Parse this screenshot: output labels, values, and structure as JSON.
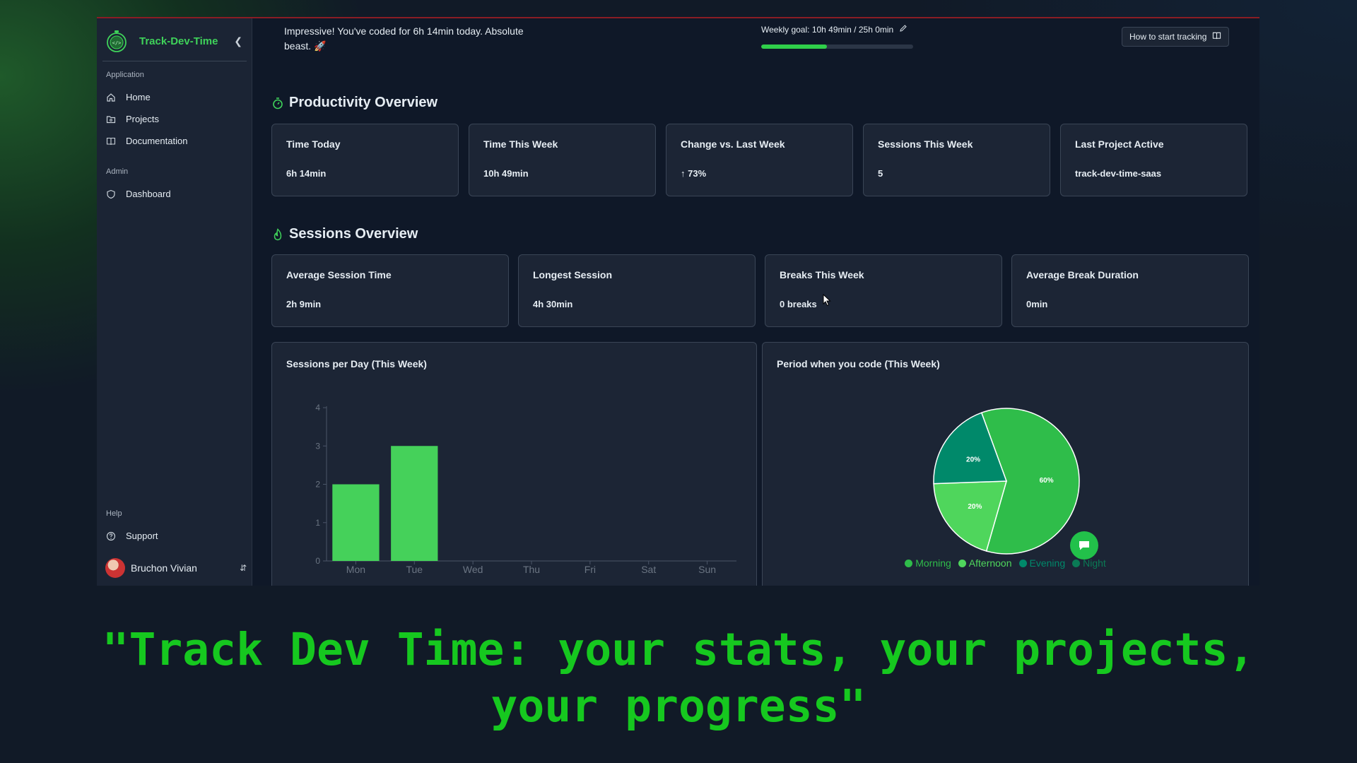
{
  "colors": {
    "accent": "#3fd25a",
    "morning": "#2fbd4a",
    "afternoon": "#4fd65c",
    "evening": "#00896a",
    "night": "#0a7a55",
    "bar": "#45d15a"
  },
  "sidebar": {
    "brand": "Track-Dev-Time",
    "groups": [
      {
        "label": "Application",
        "items": [
          {
            "label": "Home",
            "icon": "home-icon"
          },
          {
            "label": "Projects",
            "icon": "folder-icon"
          },
          {
            "label": "Documentation",
            "icon": "book-icon"
          }
        ]
      },
      {
        "label": "Admin",
        "items": [
          {
            "label": "Dashboard",
            "icon": "shield-icon"
          }
        ]
      },
      {
        "label": "Help",
        "items": [
          {
            "label": "Support",
            "icon": "help-circle-icon"
          }
        ]
      }
    ],
    "user": {
      "name": "Bruchon Vivian"
    }
  },
  "header": {
    "message": "Impressive! You've coded for 6h 14min today. Absolute beast. 🚀",
    "weekly_goal": "Weekly goal: 10h 49min / 25h 0min",
    "weekly_goal_progress": 0.433,
    "how_button": "How to start tracking"
  },
  "productivity": {
    "title": "Productivity Overview",
    "cards": [
      {
        "title": "Time Today",
        "value": "6h 14min"
      },
      {
        "title": "Time This Week",
        "value": "10h 49min"
      },
      {
        "title": "Change vs. Last Week",
        "value": "↑ 73%"
      },
      {
        "title": "Sessions This Week",
        "value": "5"
      },
      {
        "title": "Last Project Active",
        "value": "track-dev-time-saas"
      }
    ]
  },
  "sessions": {
    "title": "Sessions Overview",
    "cards": [
      {
        "title": "Average Session Time",
        "value": "2h 9min"
      },
      {
        "title": "Longest Session",
        "value": "4h 30min"
      },
      {
        "title": "Breaks This Week",
        "value": "0 breaks"
      },
      {
        "title": "Average Break Duration",
        "value": "0min"
      }
    ]
  },
  "chart_data": [
    {
      "type": "bar",
      "title": "Sessions per Day (This Week)",
      "categories": [
        "Mon",
        "Tue",
        "Wed",
        "Thu",
        "Fri",
        "Sat",
        "Sun"
      ],
      "values": [
        2,
        3,
        0,
        0,
        0,
        0,
        0
      ],
      "ylim": [
        0,
        4
      ],
      "yticks": [
        "0",
        "1",
        "2",
        "3",
        "4"
      ],
      "grid": false
    },
    {
      "type": "pie",
      "title": "Period when you code (This Week)",
      "categories": [
        "Morning",
        "Afternoon",
        "Evening",
        "Night"
      ],
      "values": [
        60,
        20,
        20,
        0
      ],
      "labels": [
        "60%",
        "20%",
        "20%",
        ""
      ],
      "legend": "bottom"
    }
  ],
  "caption": {
    "line1": "\"Track Dev Time: your stats, your projects,",
    "line2": "your progress\""
  }
}
